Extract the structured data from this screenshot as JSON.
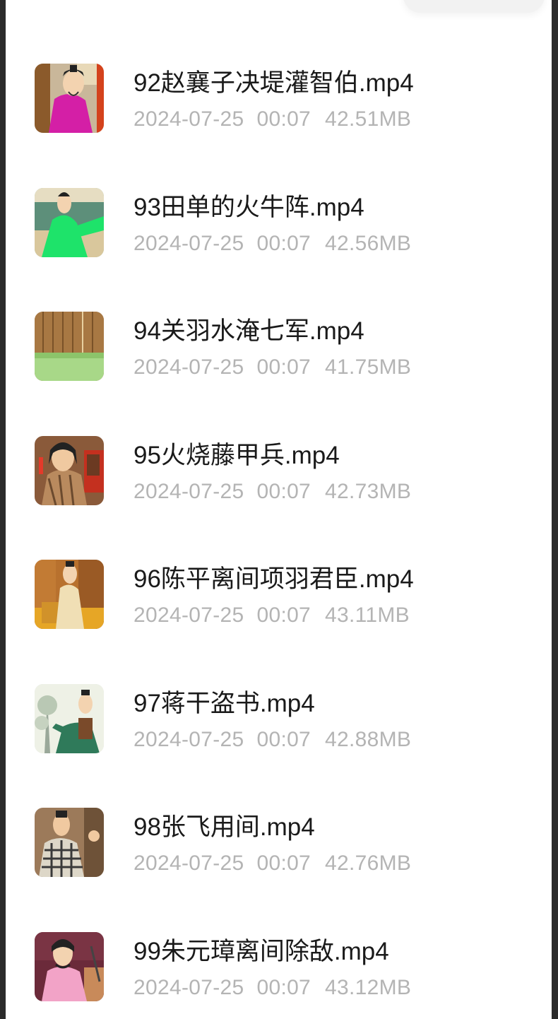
{
  "files": [
    {
      "name": "92赵襄子决堤灌智伯.mp4",
      "date": "2024-07-25",
      "time": "00:07",
      "size": "42.51MB",
      "thumbnail_icon": "cartoon-figure-magenta-robe"
    },
    {
      "name": "93田单的火牛阵.mp4",
      "date": "2024-07-25",
      "time": "00:07",
      "size": "42.56MB",
      "thumbnail_icon": "cartoon-figure-green-robe"
    },
    {
      "name": "94关羽水淹七军.mp4",
      "date": "2024-07-25",
      "time": "00:07",
      "size": "41.75MB",
      "thumbnail_icon": "wooden-fence-grass"
    },
    {
      "name": "95火烧藤甲兵.mp4",
      "date": "2024-07-25",
      "time": "00:07",
      "size": "42.73MB",
      "thumbnail_icon": "cartoon-warrior-armor"
    },
    {
      "name": "96陈平离间项羽君臣.mp4",
      "date": "2024-07-25",
      "time": "00:07",
      "size": "43.11MB",
      "thumbnail_icon": "cartoon-figure-seated-palace"
    },
    {
      "name": "97蒋干盗书.mp4",
      "date": "2024-07-25",
      "time": "00:07",
      "size": "42.88MB",
      "thumbnail_icon": "cartoon-figure-tree"
    },
    {
      "name": "98张飞用间.mp4",
      "date": "2024-07-25",
      "time": "00:07",
      "size": "42.76MB",
      "thumbnail_icon": "cartoon-soldier-checkered"
    },
    {
      "name": "99朱元璋离间除敌.mp4",
      "date": "2024-07-25",
      "time": "00:07",
      "size": "43.12MB",
      "thumbnail_icon": "cartoon-figure-pink-robe"
    }
  ]
}
